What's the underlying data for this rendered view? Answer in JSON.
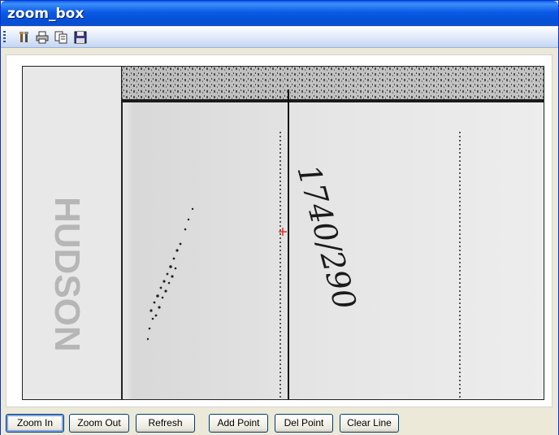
{
  "window": {
    "title": "zoom_box"
  },
  "toolbar": {
    "icons": [
      "tools-icon",
      "print-icon",
      "copy-icon",
      "save-icon"
    ]
  },
  "image": {
    "handwriting": "1740/290",
    "side_text": "HUDSON"
  },
  "buttons": {
    "zoom_in": "Zoom In",
    "zoom_out": "Zoom Out",
    "refresh": "Refresh",
    "add_point": "Add Point",
    "del_point": "Del Point",
    "clear_line": "Clear Line"
  },
  "colors": {
    "title_bar": "#0a5fe6",
    "marker": "#e0302a"
  }
}
